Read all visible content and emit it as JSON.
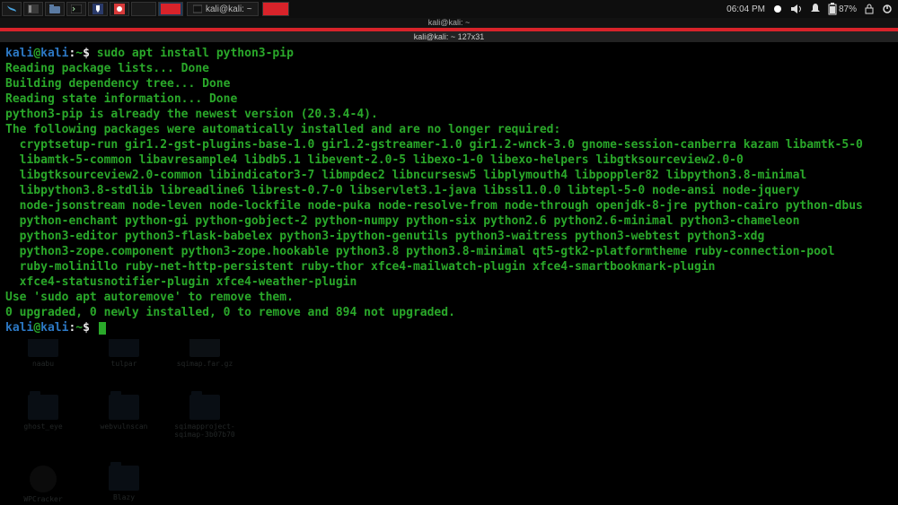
{
  "panel": {
    "clock": "06:04 PM",
    "battery": "87%",
    "task_label": "kali@kali: ~"
  },
  "window": {
    "title": "kali@kali: ~",
    "sub": "kali@kali: ~ 127x31"
  },
  "prompt": {
    "user": "kali",
    "sep": "@",
    "host": "kali",
    "colon": ":",
    "path": "~",
    "dollar": "$",
    "cmd": "sudo apt install python3-pip"
  },
  "lines": [
    "Reading package lists... Done",
    "Building dependency tree... Done",
    "Reading state information... Done",
    "python3-pip is already the newest version (20.3.4-4).",
    "The following packages were automatically installed and are no longer required:",
    "  cryptsetup-run gir1.2-gst-plugins-base-1.0 gir1.2-gstreamer-1.0 gir1.2-wnck-3.0 gnome-session-canberra kazam libamtk-5-0",
    "  libamtk-5-common libavresample4 libdb5.1 libevent-2.0-5 libexo-1-0 libexo-helpers libgtksourceview2.0-0",
    "  libgtksourceview2.0-common libindicator3-7 libmpdec2 libncursesw5 libplymouth4 libpoppler82 libpython3.8-minimal",
    "  libpython3.8-stdlib libreadline6 librest-0.7-0 libservlet3.1-java libssl1.0.0 libtepl-5-0 node-ansi node-jquery",
    "  node-jsonstream node-leven node-lockfile node-puka node-resolve-from node-through openjdk-8-jre python-cairo python-dbus",
    "  python-enchant python-gi python-gobject-2 python-numpy python-six python2.6 python2.6-minimal python3-chameleon",
    "  python3-editor python3-flask-babelex python3-ipython-genutils python3-waitress python3-webtest python3-xdg",
    "  python3-zope.component python3-zope.hookable python3.8 python3.8-minimal qt5-gtk2-platformtheme ruby-connection-pool",
    "  ruby-molinillo ruby-net-http-persistent ruby-thor xfce4-mailwatch-plugin xfce4-smartbookmark-plugin",
    "  xfce4-statusnotifier-plugin xfce4-weather-plugin",
    "Use 'sudo apt autoremove' to remove them.",
    "0 upgraded, 0 newly installed, 0 to remove and 894 not upgraded."
  ],
  "desk": {
    "r1": [
      "naabu",
      "tulpar",
      "sqimap.far.gz"
    ],
    "r2": [
      "ghost_eye",
      "webvulnscan",
      "sqimapproject-sqimap-3b07b70"
    ],
    "r3": [
      "WPCracker",
      "Blazy"
    ]
  }
}
